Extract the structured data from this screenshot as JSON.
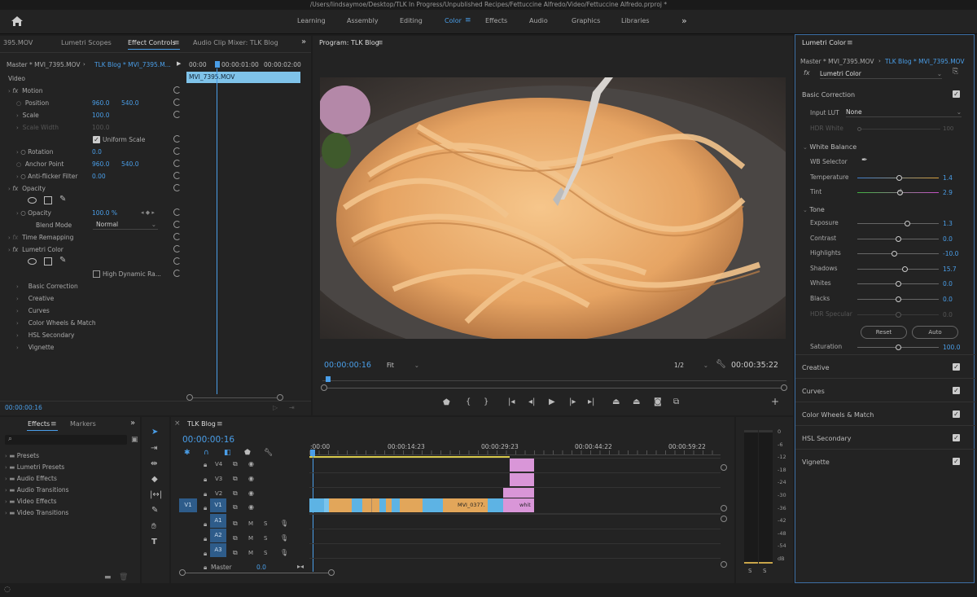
{
  "title": "/Users/lindsaymoe/Desktop/TLK In Progress/Unpublished Recipes/Fettuccine Alfredo/Video/Fettuccine Alfredo.prproj *",
  "workspaces": [
    "Learning",
    "Assembly",
    "Editing",
    "Color",
    "Effects",
    "Audio",
    "Graphics",
    "Libraries"
  ],
  "active_workspace": "Color",
  "more_glyph": "»",
  "source_panel": {
    "tabs": [
      "395.MOV",
      "Lumetri Scopes",
      "Effect Controls",
      "Audio Clip Mixer: TLK Blog"
    ],
    "master_clip": "Master * MVI_7395.MOV",
    "sequence_clip": "TLK Blog * MVI_7395.M...",
    "ruler": [
      "00:00",
      "00:00:01:00",
      "00:00:02:00"
    ],
    "clip_label": "MVI_7395.MOV",
    "video_label": "Video",
    "timecode": "00:00:00:16",
    "rows": [
      {
        "label": "Motion",
        "type": "fx"
      },
      {
        "label": "Position",
        "v1": "960.0",
        "v2": "540.0"
      },
      {
        "label": "Scale",
        "v1": "100.0"
      },
      {
        "label": "Scale Width",
        "v1": "100.0",
        "dim": true
      },
      {
        "label": "Uniform Scale",
        "type": "check"
      },
      {
        "label": "Rotation",
        "v1": "0.0"
      },
      {
        "label": "Anchor Point",
        "v1": "960.0",
        "v2": "540.0"
      },
      {
        "label": "Anti-flicker Filter",
        "v1": "0.00"
      },
      {
        "label": "Opacity",
        "type": "fx"
      },
      {
        "label": "",
        "type": "masks"
      },
      {
        "label": "Opacity",
        "v1": "100.0 %"
      },
      {
        "label": "Blend Mode",
        "select": "Normal"
      },
      {
        "label": "Time Remapping",
        "type": "fx"
      },
      {
        "label": "Lumetri Color",
        "type": "fx"
      },
      {
        "label": "High Dynamic Ra...",
        "type": "maskscheck"
      },
      {
        "label": "Basic Correction",
        "type": "section"
      },
      {
        "label": "Creative",
        "type": "section"
      },
      {
        "label": "Curves",
        "type": "section"
      },
      {
        "label": "Color Wheels & Match",
        "type": "section"
      },
      {
        "label": "HSL Secondary",
        "type": "section"
      },
      {
        "label": "Vignette",
        "type": "section"
      }
    ]
  },
  "program": {
    "title": "Program: TLK Blog",
    "timecode": "00:00:00:16",
    "fit": "Fit",
    "resolution": "1/2",
    "duration": "00:00:35:22"
  },
  "effects_panel": {
    "tabs": [
      "Effects",
      "Markers"
    ],
    "items": [
      "Presets",
      "Lumetri Presets",
      "Audio Effects",
      "Audio Transitions",
      "Video Effects",
      "Video Transitions"
    ]
  },
  "timeline": {
    "title": "TLK Blog",
    "timecode": "00:00:00:16",
    "ruler": [
      ":00:00",
      "00:00:14:23",
      "00:00:29:23",
      "00:00:44:22",
      "00:00:59:22"
    ],
    "video_tracks": [
      "V4",
      "V3",
      "V2",
      "V1"
    ],
    "audio_tracks": [
      "A1",
      "A2",
      "A3"
    ],
    "master": "Master",
    "master_val": "0.0",
    "clip_name": "MVI_0377.",
    "clip_name2": "whit",
    "src_patch": "V1",
    "mute": "M",
    "solo": "S"
  },
  "meter": {
    "scale": [
      "0",
      "-6",
      "-12",
      "-18",
      "-24",
      "-30",
      "-36",
      "-42",
      "-48",
      "-54",
      "dB"
    ],
    "solo": "S"
  },
  "lumetri": {
    "title": "Lumetri Color",
    "master_clip": "Master * MVI_7395.MOV",
    "sequence_clip": "TLK Blog * MVI_7395.MOV",
    "effect": "Lumetri Color",
    "basic_correction": "Basic Correction",
    "input_lut_label": "Input LUT",
    "input_lut": "None",
    "hdr_white_label": "HDR White",
    "hdr_white": "100",
    "white_balance": "White Balance",
    "wb_selector": "WB Selector",
    "temperature_label": "Temperature",
    "temperature": "1.4",
    "tint_label": "Tint",
    "tint": "2.9",
    "tone": "Tone",
    "tone_rows": [
      {
        "label": "Exposure",
        "value": "1.3",
        "pos": 0.61
      },
      {
        "label": "Contrast",
        "value": "0.0",
        "pos": 0.5
      },
      {
        "label": "Highlights",
        "value": "-10.0",
        "pos": 0.45
      },
      {
        "label": "Shadows",
        "value": "15.7",
        "pos": 0.58
      },
      {
        "label": "Whites",
        "value": "0.0",
        "pos": 0.5
      },
      {
        "label": "Blacks",
        "value": "0.0",
        "pos": 0.5
      },
      {
        "label": "HDR Specular",
        "value": "0.0",
        "pos": 0.5,
        "dim": true
      }
    ],
    "reset": "Reset",
    "auto": "Auto",
    "saturation_label": "Saturation",
    "saturation": "100.0",
    "sections": [
      "Creative",
      "Curves",
      "Color Wheels & Match",
      "HSL Secondary",
      "Vignette"
    ]
  },
  "colors": {
    "accent": "#4a9ee8",
    "clip_video": "#e2a65a",
    "clip_pink": "#d996d8",
    "clip_blue": "#5db3e4"
  }
}
